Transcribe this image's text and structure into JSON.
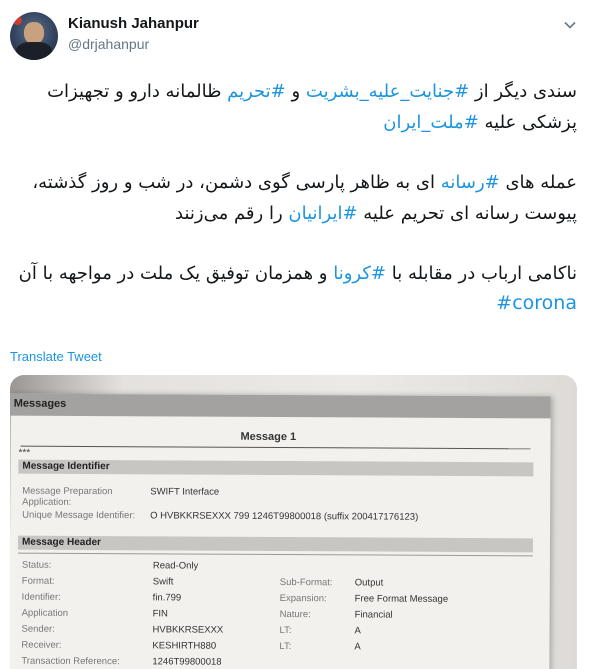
{
  "header": {
    "display_name": "Kianush Jahanpur",
    "handle": "@drjahanpur"
  },
  "tweet": {
    "p1_a": "سندی دیگر از ",
    "p1_tag1": "#جنایت_علیه_بشریت",
    "p1_b": " و ",
    "p1_tag2": "#تحریم",
    "p1_c": " ظالمانه دارو و تجهیزات پزشکی علیه ",
    "p1_tag3": "#ملت_ایران",
    "p2_a": "عمله های ",
    "p2_tag1": "#رسانه",
    "p2_b": " ای به ظاهر پارسی  گوی دشمن، در شب و روز گذشته، پیوست رسانه ای تحریم علیه ",
    "p2_tag2": "#ایرانیان",
    "p2_c": " را رقم می‌زنند",
    "p3_a": "ناکامی ارباب در مقابله با ",
    "p3_tag1": "#کرونا",
    "p3_b": " و  همزمان توفیق یک ملت در مواجهه با آن",
    "p3_tag2": "#corona"
  },
  "translate_label": "Translate Tweet",
  "media": {
    "bar_label": "Messages",
    "message_title": "Message 1",
    "stars": "***",
    "section1": "Message Identifier",
    "prep_label": "Message Preparation Application:",
    "prep_value": "SWIFT Interface",
    "unique_label": "Unique Message Identifier:",
    "unique_value": "O HVBKKRSEXXX 799 1246T99800018 (suffix 200417176123)",
    "section2": "Message Header",
    "status_label": "Status:",
    "status_value": "Read-Only",
    "format_label": "Format:",
    "format_value": "Swift",
    "subformat_label": "Sub-Format:",
    "subformat_value": "Output",
    "identifier_label": "Identifier:",
    "identifier_value": "fin.799",
    "expansion_label": "Expansion:",
    "expansion_value": "Free Format Message",
    "application_label": "Application",
    "application_value": "FIN",
    "nature_label": "Nature:",
    "nature_value": "Financial",
    "sender_label": "Sender:",
    "sender_value": "HVBKKRSEXXX",
    "lt1_label": "LT:",
    "lt1_value": "A",
    "receiver_label": "Receiver:",
    "receiver_value": "KESHIRTH880",
    "lt2_label": "LT:",
    "lt2_value": "A",
    "txref_label": "Transaction Reference:",
    "txref_value": "1246T99800018"
  },
  "colors": {
    "link": "#1b95e0",
    "text": "#14171a",
    "muted": "#657786"
  }
}
